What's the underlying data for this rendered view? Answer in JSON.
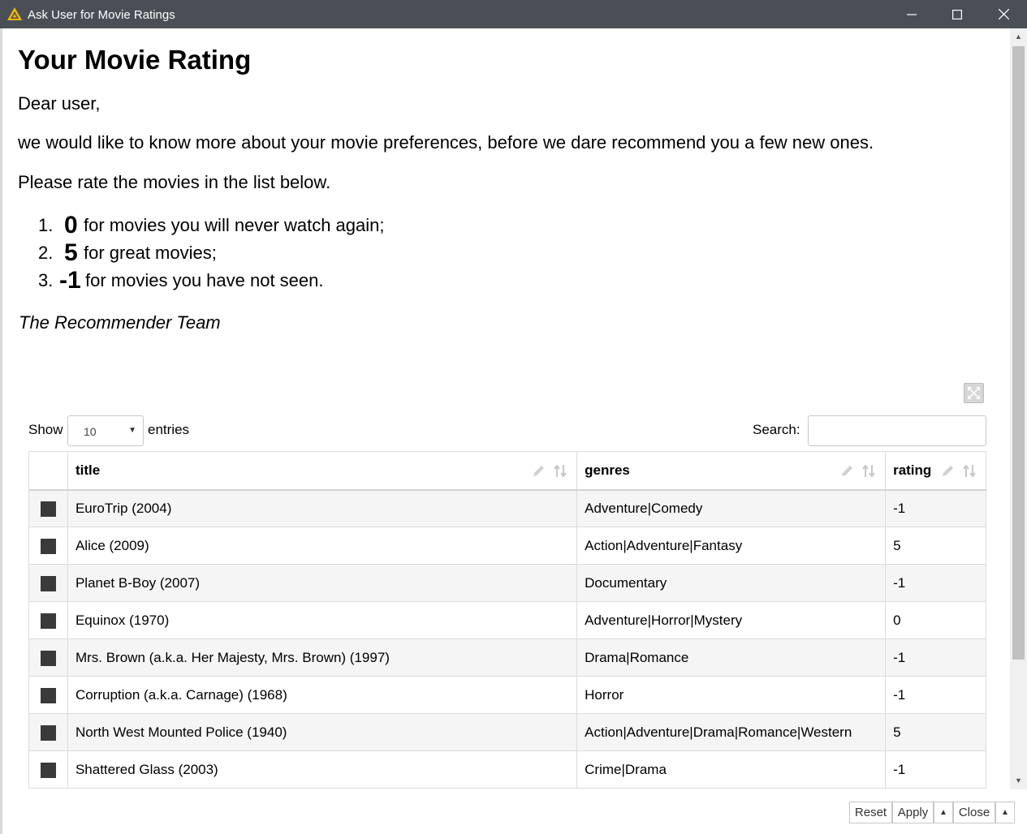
{
  "window": {
    "title": "Ask User for Movie Ratings"
  },
  "page": {
    "heading": "Your Movie Rating",
    "greeting": "Dear user,",
    "intro": "we would like to know more about your movie preferences, before we dare recommend you a few new ones.",
    "instruction": "Please rate the movies in the list below.",
    "rules": [
      {
        "num": "1.",
        "value": "0",
        "text": "for movies you will never watch again;"
      },
      {
        "num": "2.",
        "value": "5",
        "text": "for great movies;"
      },
      {
        "num": "3.",
        "value": "-1",
        "text": "for movies you have not seen."
      }
    ],
    "signature": "The Recommender Team"
  },
  "table_controls": {
    "show_label": "Show",
    "entries_value": "10",
    "entries_label": "entries",
    "search_label": "Search:",
    "search_value": ""
  },
  "table": {
    "headers": [
      "title",
      "genres",
      "rating"
    ],
    "rows": [
      {
        "title": "EuroTrip (2004)",
        "genres": "Adventure|Comedy",
        "rating": "-1"
      },
      {
        "title": "Alice (2009)",
        "genres": "Action|Adventure|Fantasy",
        "rating": "5"
      },
      {
        "title": "Planet B-Boy (2007)",
        "genres": "Documentary",
        "rating": "-1"
      },
      {
        "title": "Equinox (1970)",
        "genres": "Adventure|Horror|Mystery",
        "rating": "0"
      },
      {
        "title": "Mrs. Brown (a.k.a. Her Majesty, Mrs. Brown) (1997)",
        "genres": "Drama|Romance",
        "rating": "-1"
      },
      {
        "title": "Corruption (a.k.a. Carnage) (1968)",
        "genres": "Horror",
        "rating": "-1"
      },
      {
        "title": "North West Mounted Police (1940)",
        "genres": "Action|Adventure|Drama|Romance|Western",
        "rating": "5"
      },
      {
        "title": "Shattered Glass (2003)",
        "genres": "Crime|Drama",
        "rating": "-1"
      }
    ]
  },
  "footer": {
    "reset_label": "Reset",
    "apply_label": "Apply",
    "close_label": "Close"
  },
  "icons": {
    "app": "knime-warning-triangle-icon",
    "minimize": "minimize-icon",
    "maximize": "maximize-icon",
    "close": "close-icon",
    "fullscreen": "fullscreen-icon",
    "edit": "pencil-icon",
    "sort": "sort-icon"
  },
  "colors": {
    "titlebar": "#4a4f55",
    "app_icon": "#f2b705",
    "row_stripe": "#f5f5f5",
    "checkbox": "#3a3a3a"
  }
}
